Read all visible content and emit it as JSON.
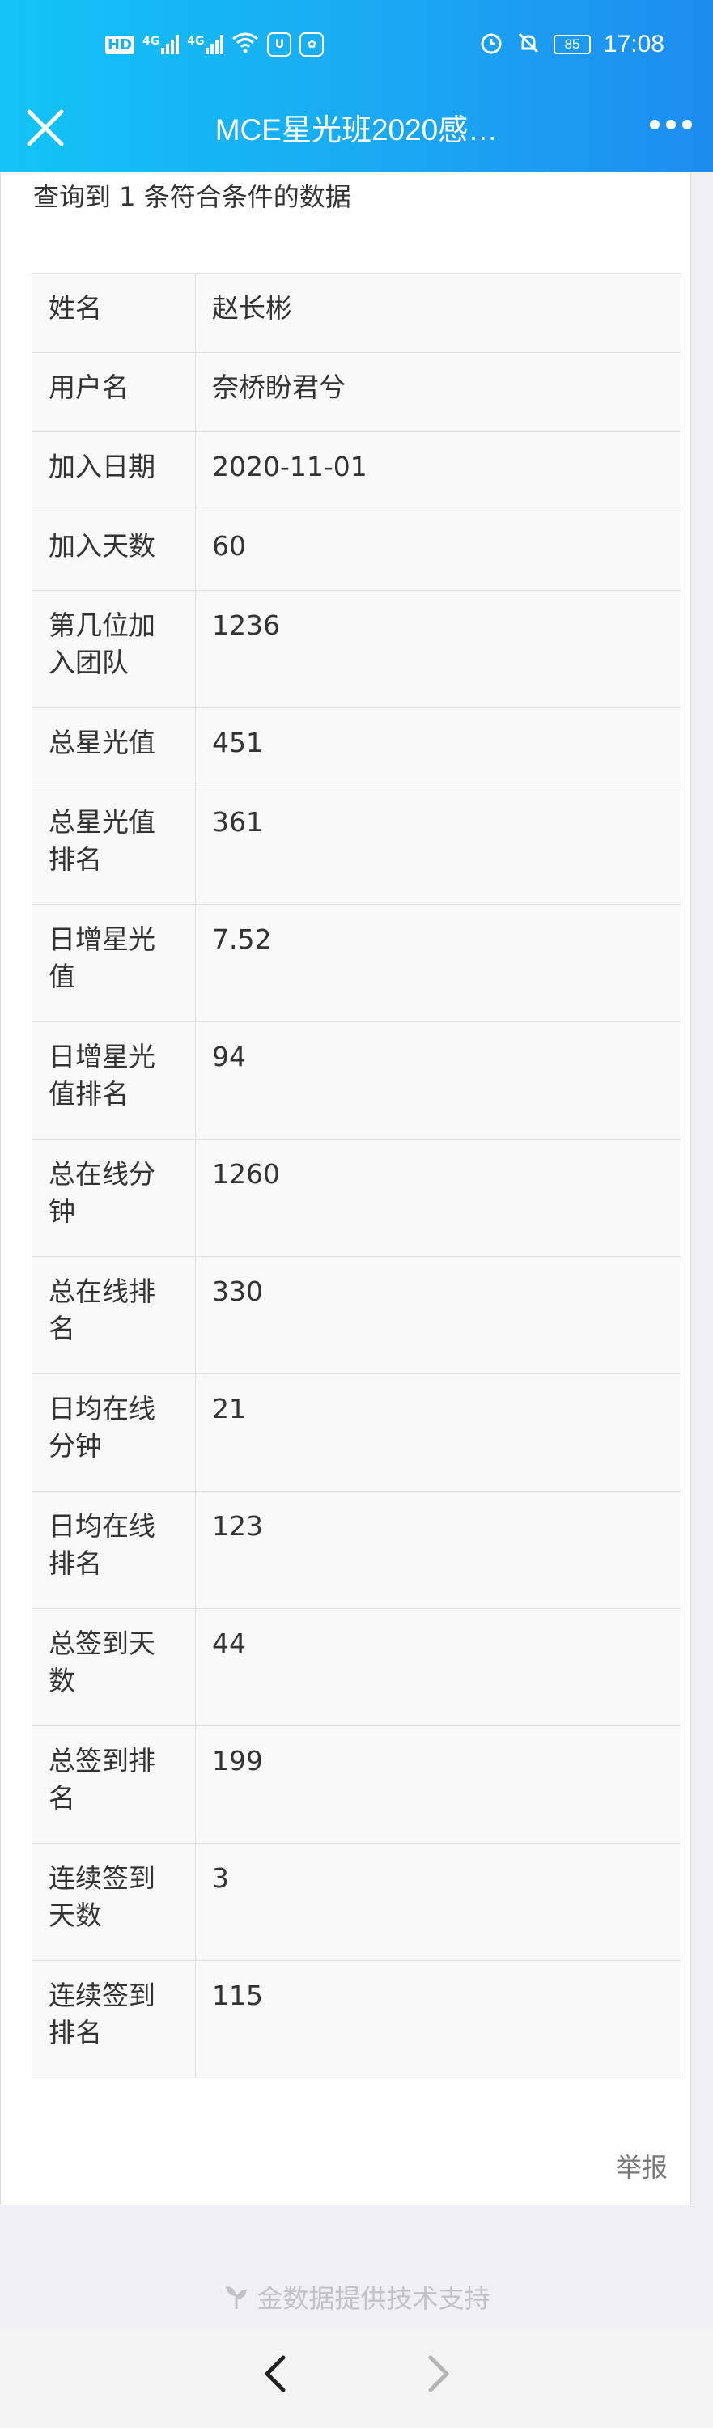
{
  "status_bar": {
    "left_icons": [
      "hd-icon",
      "signal-4g-icon",
      "signal-4g-icon",
      "wifi-icon",
      "app-badge-icon",
      "baidu-icon"
    ],
    "hd_label": "HD",
    "net_label_1": "4G",
    "net_label_2": "4G",
    "right_icons": [
      "alarm-icon",
      "mute-icon"
    ],
    "battery": "85",
    "time": "17:08"
  },
  "nav": {
    "title": "MCE星光班2020感…",
    "close_icon": "close-icon",
    "more_icon": "more-icon"
  },
  "result_text": "查询到 1 条符合条件的数据",
  "table": [
    {
      "key": "姓名",
      "value": "赵长彬"
    },
    {
      "key": "用户名",
      "value": "奈桥盼君兮"
    },
    {
      "key": "加入日期",
      "value": "2020-11-01"
    },
    {
      "key": "加入天数",
      "value": "60"
    },
    {
      "key": "第几位加入团队",
      "value": "1236"
    },
    {
      "key": "总星光值",
      "value": "451"
    },
    {
      "key": "总星光值排名",
      "value": "361"
    },
    {
      "key": "日增星光值",
      "value": "7.52"
    },
    {
      "key": "日增星光值排名",
      "value": "94"
    },
    {
      "key": "总在线分钟",
      "value": "1260"
    },
    {
      "key": "总在线排名",
      "value": "330"
    },
    {
      "key": "日均在线分钟",
      "value": "21"
    },
    {
      "key": "日均在线排名",
      "value": "123"
    },
    {
      "key": "总签到天数",
      "value": "44"
    },
    {
      "key": "总签到排名",
      "value": "199"
    },
    {
      "key": "连续签到天数",
      "value": "3"
    },
    {
      "key": "连续签到排名",
      "value": "115"
    }
  ],
  "report_label": "举报",
  "footer_text": "金数据提供技术支持",
  "colors": {
    "header_start": "#12c4f6",
    "header_end": "#1d8df0",
    "background": "#efeff4"
  }
}
